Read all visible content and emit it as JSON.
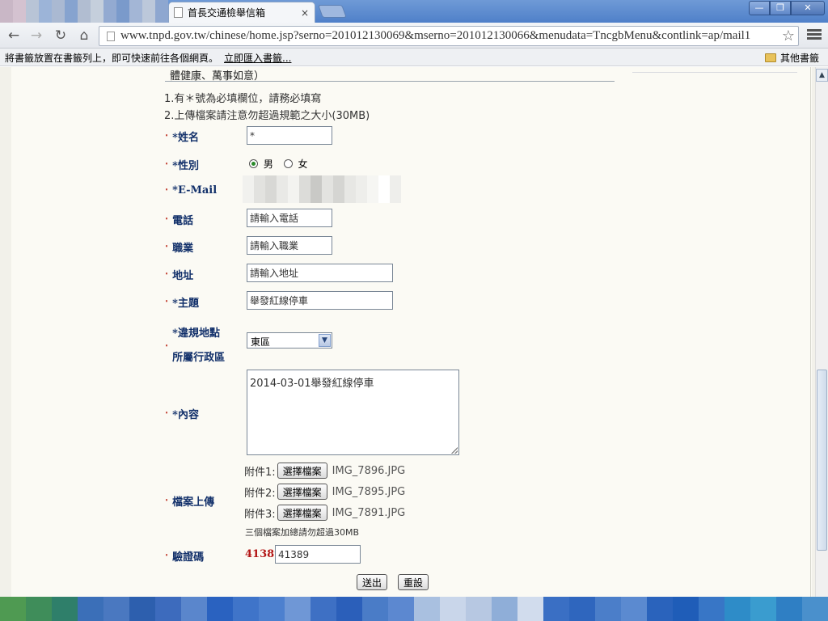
{
  "browser": {
    "tab_title": "首長交通檢舉信箱",
    "tab_close": "×",
    "url": "www.tnpd.gov.tw/chinese/home.jsp?serno=201012130069&mserno=201012130066&menudata=TncgbMenu&contlink=ap/mail1",
    "window_min": "—",
    "window_max": "❐",
    "window_close": "✕",
    "nav_back": "←",
    "nav_forward": "→",
    "nav_reload": "↻",
    "nav_home": "⌂",
    "star": "☆"
  },
  "bookmarks": {
    "hint": "將書籤放置在書籤列上，即可快速前往各個網頁。",
    "import_link": "立即匯入書籤...",
    "other": "其他書籤"
  },
  "page": {
    "previous_text": "體健康、萬事如意）",
    "note1": "1.有＊號為必填欄位，請務必填寫",
    "note2": "2.上傳檔案請注意勿超過規範之大小(30MB)"
  },
  "form": {
    "bullet": "‧",
    "name_label": "*姓名",
    "name_value": "*",
    "gender_label": "*性別",
    "gender_male": "男",
    "gender_female": "女",
    "email_label": "*E-Mail",
    "phone_label": "電話",
    "phone_value": "請輸入電話",
    "job_label": "職業",
    "job_value": "請輸入職業",
    "address_label": "地址",
    "address_value": "請輸入地址",
    "subject_label": "*主題",
    "subject_value": "舉發紅線停車",
    "location_label_1": "*違規地點",
    "location_label_2": "所屬行政區",
    "district_selected": "東區",
    "content_label": "*內容",
    "content_value": "2014-03-01舉發紅線停車",
    "upload_label": "檔案上傳",
    "attachments": [
      {
        "label": "附件1:",
        "button": "選擇檔案",
        "file": "IMG_7896.JPG"
      },
      {
        "label": "附件2:",
        "button": "選擇檔案",
        "file": "IMG_7895.JPG"
      },
      {
        "label": "附件3:",
        "button": "選擇檔案",
        "file": "IMG_7891.JPG"
      }
    ],
    "size_note": "三個檔案加總請勿超過30MB",
    "captcha_label": "驗證碼",
    "captcha_code": "41389",
    "captcha_value": "41389",
    "submit_label": "送出",
    "reset_label": "重設"
  },
  "scrollbar": {
    "up_arrow": "▲",
    "position": 0.85
  },
  "colors": {
    "label_blue": "#12306a",
    "bullet_red": "#c0392b",
    "captcha_red": "#b31515",
    "page_bg": "#fbfaf4"
  }
}
